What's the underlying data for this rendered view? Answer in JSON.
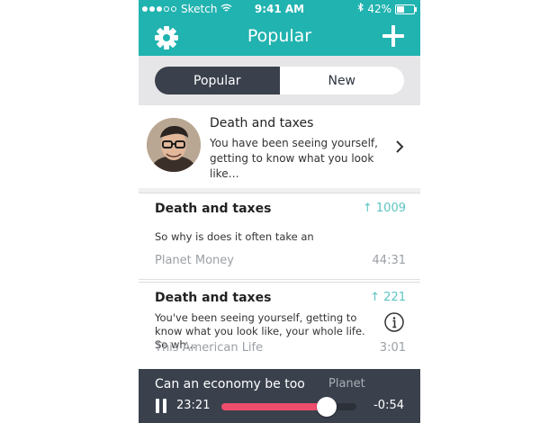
{
  "status_bar": {
    "carrier": "Sketch",
    "time": "9:41 AM",
    "battery": "42%",
    "battery_level": 0.42
  },
  "nav": {
    "title": "Popular",
    "left_icon": "gear-icon",
    "right_icon": "plus-icon"
  },
  "tabs": [
    {
      "label": "Popular",
      "active": true
    },
    {
      "label": "New",
      "active": false
    }
  ],
  "featured": {
    "title": "Death and taxes",
    "description": "You have been seeing yourself, getting to know what you look like…",
    "icon": "chevron-right-icon"
  },
  "episodes": [
    {
      "title": "Death and taxes",
      "count": "1009",
      "description": "So why is does it often take an",
      "source": "Planet Money",
      "duration": "44:31"
    },
    {
      "title": "Death and taxes",
      "count": "221",
      "description": "You've been seeing yourself, getting to know what you look like, your whole life. So wh...",
      "source": "This American Life",
      "duration": "3:01",
      "icon": "info-icon"
    }
  ],
  "player": {
    "title": "Can an economy be too",
    "source": "Planet",
    "elapsed": "23:21",
    "remaining": "-0:54",
    "progress": 0.78
  },
  "colors": {
    "accent": "#21b3b0",
    "dark": "#3a414d",
    "progress": "#ef4d6c",
    "count": "#5cc4c2"
  }
}
